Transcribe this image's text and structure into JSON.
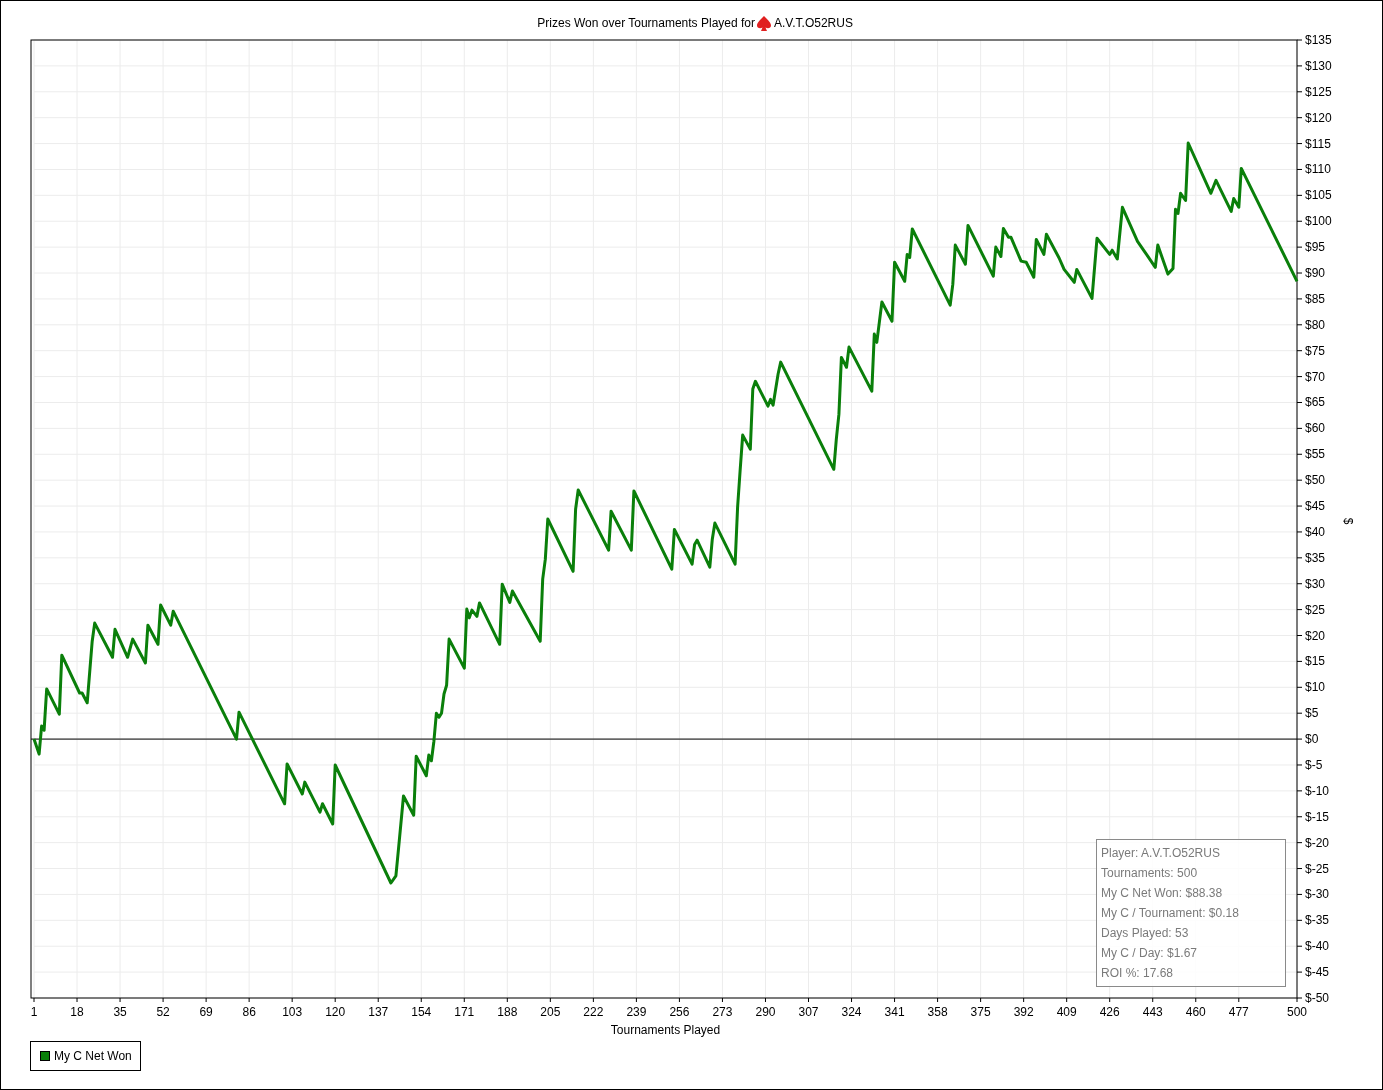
{
  "title": {
    "prefix": "Prizes Won over Tournaments Played for",
    "player": "A.V.T.O52RUS"
  },
  "chart_data": {
    "type": "line",
    "grid": true,
    "xlabel": "Tournaments Played",
    "ylabel": "$",
    "xlim": [
      1,
      500
    ],
    "ylim": [
      -50,
      135
    ],
    "xticks": [
      1,
      18,
      35,
      52,
      69,
      86,
      103,
      120,
      137,
      154,
      171,
      188,
      205,
      222,
      239,
      256,
      273,
      290,
      307,
      324,
      341,
      358,
      375,
      392,
      409,
      426,
      443,
      460,
      477,
      500
    ],
    "yticks": [
      {
        "value": 135,
        "label": "$135"
      },
      {
        "value": 130,
        "label": "$130"
      },
      {
        "value": 125,
        "label": "$125"
      },
      {
        "value": 120,
        "label": "$120"
      },
      {
        "value": 115,
        "label": "$115"
      },
      {
        "value": 110,
        "label": "$110"
      },
      {
        "value": 105,
        "label": "$105"
      },
      {
        "value": 100,
        "label": "$100"
      },
      {
        "value": 95,
        "label": "$95"
      },
      {
        "value": 90,
        "label": "$90"
      },
      {
        "value": 85,
        "label": "$85"
      },
      {
        "value": 80,
        "label": "$80"
      },
      {
        "value": 75,
        "label": "$75"
      },
      {
        "value": 70,
        "label": "$70"
      },
      {
        "value": 65,
        "label": "$65"
      },
      {
        "value": 60,
        "label": "$60"
      },
      {
        "value": 55,
        "label": "$55"
      },
      {
        "value": 50,
        "label": "$50"
      },
      {
        "value": 45,
        "label": "$45"
      },
      {
        "value": 40,
        "label": "$40"
      },
      {
        "value": 35,
        "label": "$35"
      },
      {
        "value": 30,
        "label": "$30"
      },
      {
        "value": 25,
        "label": "$25"
      },
      {
        "value": 20,
        "label": "$20"
      },
      {
        "value": 15,
        "label": "$15"
      },
      {
        "value": 10,
        "label": "$10"
      },
      {
        "value": 5,
        "label": "$5"
      },
      {
        "value": 0,
        "label": "$0"
      },
      {
        "value": -5,
        "label": "$-5"
      },
      {
        "value": -10,
        "label": "$-10"
      },
      {
        "value": -15,
        "label": "$-15"
      },
      {
        "value": -20,
        "label": "$-20"
      },
      {
        "value": -25,
        "label": "$-25"
      },
      {
        "value": -30,
        "label": "$-30"
      },
      {
        "value": -35,
        "label": "$-35"
      },
      {
        "value": -40,
        "label": "$-40"
      },
      {
        "value": -45,
        "label": "$-45"
      },
      {
        "value": -50,
        "label": "$-50"
      }
    ],
    "x": [
      1,
      3,
      4,
      5,
      6,
      11,
      12,
      19,
      20,
      22,
      24,
      25,
      32,
      33,
      38,
      40,
      45,
      46,
      50,
      51,
      55,
      56,
      81,
      82,
      100,
      101,
      107,
      108,
      114,
      115,
      119,
      120,
      142,
      144,
      145,
      147,
      151,
      152,
      156,
      157,
      158,
      159,
      160,
      161,
      162,
      163,
      164,
      165,
      171,
      172,
      173,
      174,
      176,
      177,
      185,
      186,
      189,
      190,
      201,
      202,
      203,
      204,
      214,
      215,
      216,
      228,
      229,
      237,
      238,
      253,
      254,
      261,
      262,
      263,
      268,
      269,
      270,
      278,
      279,
      280,
      281,
      284,
      285,
      286,
      291,
      292,
      293,
      295,
      296,
      317,
      318,
      319,
      320,
      322,
      323,
      332,
      333,
      334,
      336,
      340,
      341,
      345,
      346,
      347,
      348,
      363,
      364,
      365,
      369,
      370,
      380,
      381,
      383,
      384,
      386,
      387,
      391,
      393,
      396,
      397,
      400,
      401,
      406,
      408,
      412,
      413,
      419,
      421,
      426,
      427,
      429,
      431,
      437,
      440,
      444,
      445,
      449,
      451,
      452,
      453,
      454,
      456,
      457,
      466,
      468,
      474,
      475,
      477,
      478,
      500
    ],
    "series": [
      {
        "name": "My C Net Won",
        "color": "#0a7f0a",
        "values": [
          0,
          -2.9,
          2.5,
          1.7,
          9.7,
          4.8,
          16.2,
          8.9,
          8.9,
          7,
          18.9,
          22.4,
          15.8,
          21.2,
          15.8,
          19.3,
          14.7,
          22,
          18.3,
          25.9,
          22,
          24.7,
          0,
          5.2,
          -12.5,
          -4.8,
          -10.6,
          -8.3,
          -14.1,
          -12.5,
          -16.4,
          -5,
          -27.8,
          -26.4,
          -21.2,
          -11,
          -14.7,
          -3.3,
          -7.1,
          -3.1,
          -4.2,
          -0.4,
          5,
          4.2,
          5,
          8.7,
          10.4,
          19.3,
          13.7,
          25.1,
          23.4,
          24.9,
          23.7,
          26.3,
          18.3,
          29.9,
          26.4,
          28.6,
          18.9,
          30.9,
          34.7,
          42.5,
          32.4,
          44.4,
          48.1,
          36.5,
          44,
          36.5,
          47.9,
          32.8,
          40.5,
          33.8,
          37.6,
          38.4,
          33.2,
          38.6,
          41.7,
          33.8,
          44.8,
          52.1,
          58.7,
          56,
          67.6,
          69.1,
          64.3,
          65.6,
          64.5,
          70.5,
          72.8,
          52.1,
          57.9,
          62.7,
          73.7,
          71.8,
          75.7,
          67.2,
          78.2,
          76.6,
          84.4,
          80.7,
          92.1,
          88.4,
          93.6,
          93,
          98.5,
          83.8,
          87.8,
          95.4,
          91.7,
          99.2,
          89.4,
          95,
          93.2,
          98.6,
          96.9,
          96.9,
          92.3,
          92.1,
          89.2,
          96.5,
          93.6,
          97.5,
          92.9,
          90.7,
          88.2,
          90.7,
          85.1,
          96.7,
          93.6,
          94.4,
          92.7,
          102.7,
          96.1,
          94,
          91.1,
          95.4,
          89.8,
          90.9,
          102.3,
          101.5,
          105.4,
          104,
          115.1,
          105.4,
          107.9,
          101.9,
          104.4,
          102.7,
          110.2,
          88.4
        ]
      }
    ]
  },
  "stats_box": [
    "Player: A.V.T.O52RUS",
    "Tournaments: 500",
    "My C Net Won: $88.38",
    "My C / Tournament: $0.18",
    "Days Played: 53",
    "My C / Day: $1.67",
    "ROI %: 17.68"
  ]
}
